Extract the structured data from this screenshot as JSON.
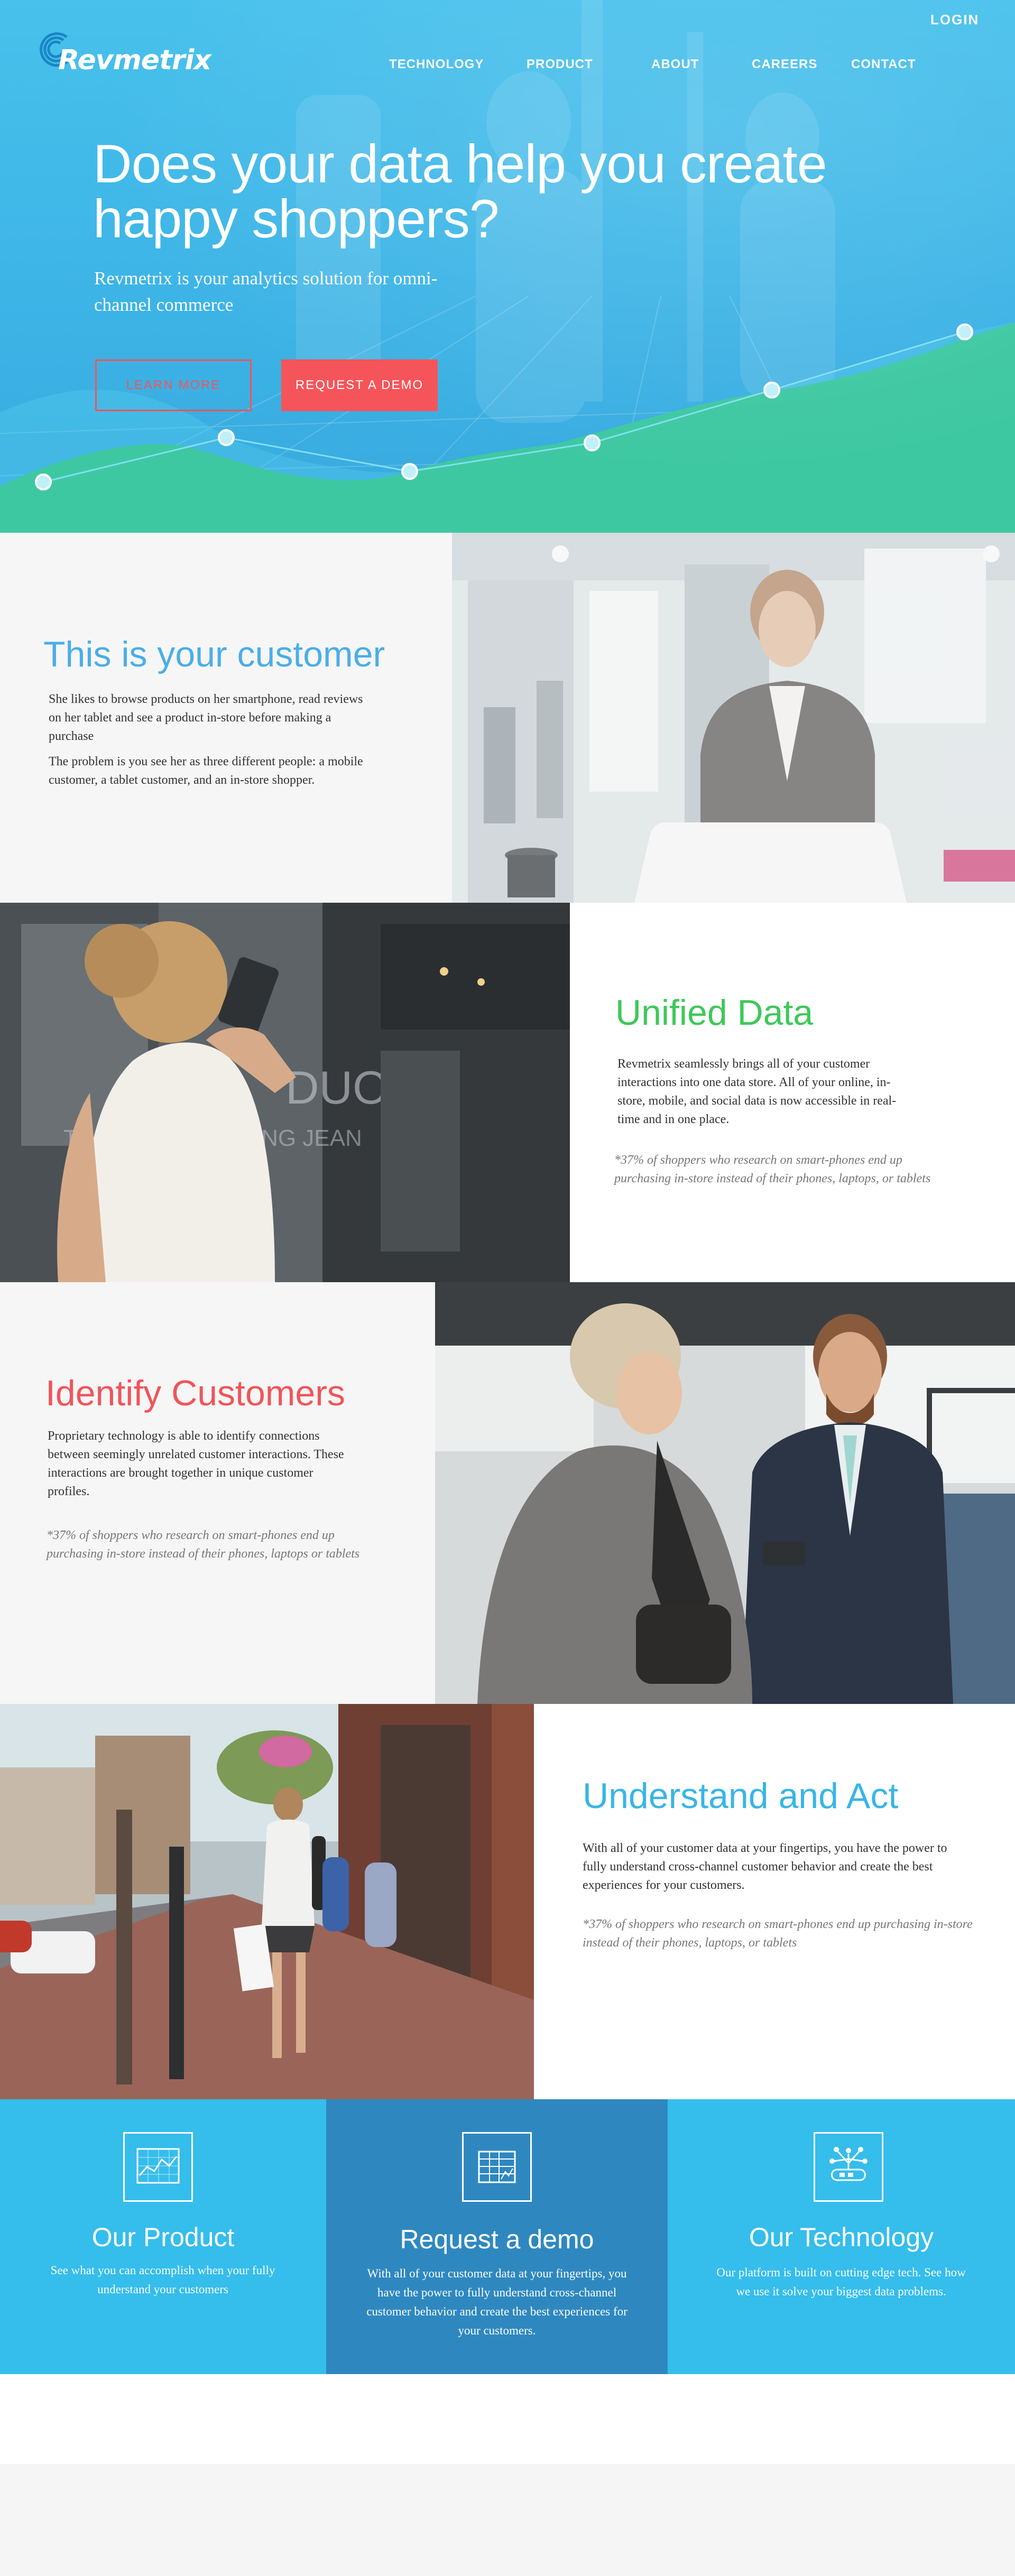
{
  "header": {
    "logo_text": "Revmetrix",
    "login": "LOGIN",
    "nav": [
      "TECHNOLOGY",
      "PRODUCT",
      "ABOUT",
      "CAREERS",
      "CONTACT"
    ]
  },
  "hero": {
    "title": "Does your data help you create happy shoppers?",
    "subtitle": "Revmetrix is your analytics solution for omni-channel commerce",
    "learn_more": "LEARN MORE",
    "request_demo": "REQUEST A DEMO"
  },
  "customer": {
    "title": "This is your customer",
    "p1": "She likes to browse products on her smartphone, read reviews on her tablet and see a product in-store before making a purchase",
    "p2": "The problem is you see her as three different people: a mobile customer, a tablet customer, and an in-store shopper.",
    "color": "#4aaee8"
  },
  "unified": {
    "title": "Unified Data",
    "body": "Revmetrix seamlessly brings all of your customer interactions into one data store. All of your online, in-store, mobile, and social data is now accessible in real-time and in one place.",
    "note": "*37% of shoppers who research on smart-phones end up purchasing in-store instead of their phones, laptops, or tablets",
    "color": "#3fc85a"
  },
  "identify": {
    "title": "Identify Customers",
    "body": "Proprietary technology is able to identify connections between seemingly unrelated customer interactions. These interactions are brought together in unique customer profiles.",
    "note": "*37% of shoppers who research on smart-phones end up purchasing in-store instead of their phones, laptops or tablets",
    "color": "#f0555a"
  },
  "understand": {
    "title": "Understand and Act",
    "body": "With all of your customer data at your fingertips, you have the power to fully understand cross-channel customer behavior and create the best experiences for your customers.",
    "note": "*37% of shoppers who research on smart-phones end up purchasing in-store instead of their phones, laptops, or tablets",
    "color": "#39b5e6"
  },
  "tiles": [
    {
      "title": "Our Product",
      "text": "See what you can accomplish when your fully understand your customers",
      "icon": "chart-icon",
      "color": "#35bdec"
    },
    {
      "title": "Request a demo",
      "text": "With all of your customer data at your fingertips, you have the power to fully understand cross-channel customer behavior and create the best experiences for your customers.",
      "icon": "spreadsheet-icon",
      "color": "#2e88bf"
    },
    {
      "title": "Our Technology",
      "text": "Our platform is built on cutting edge tech. See how we use it solve your biggest data problems.",
      "icon": "network-icon",
      "color": "#35bdec"
    }
  ],
  "colors": {
    "hero_blue": "#3db4e6",
    "accent_red": "#f5555a",
    "teal": "#3ec8a2"
  }
}
